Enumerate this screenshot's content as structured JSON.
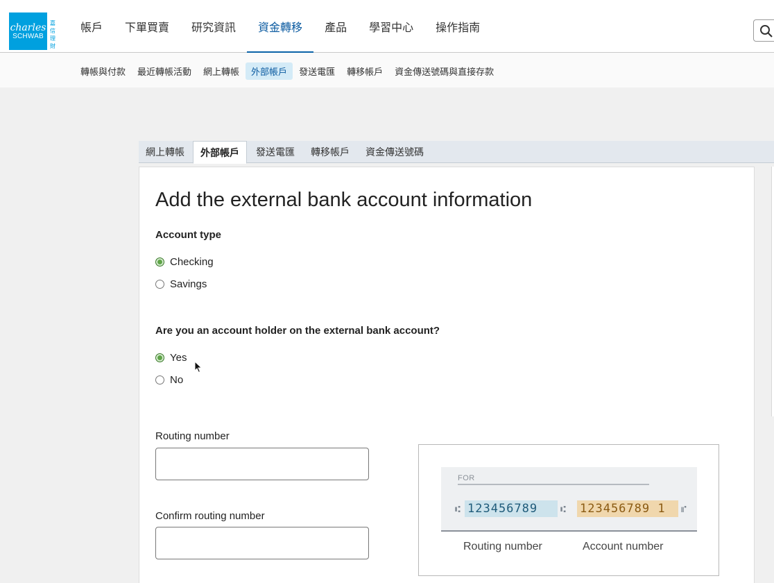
{
  "brand": {
    "logo_line1": "charles",
    "logo_line2": "SCHWAB",
    "logo_cn": "嘉信理財"
  },
  "main_nav": [
    "帳戶",
    "下單買賣",
    "研究資訊",
    "資金轉移",
    "產品",
    "學習中心",
    "操作指南"
  ],
  "main_nav_active": "資金轉移",
  "sub_nav": [
    "轉帳與付款",
    "最近轉帳活動",
    "網上轉帳",
    "外部帳戶",
    "發送電匯",
    "轉移帳戶",
    "資金傳送號碼與直接存款"
  ],
  "sub_nav_active": "外部帳戶",
  "tabs": [
    "網上轉帳",
    "外部帳戶",
    "發送電匯",
    "轉移帳戶",
    "資金傳送號碼"
  ],
  "tab_active": "外部帳戶",
  "form": {
    "title": "Add the external bank account information",
    "account_type": {
      "label": "Account type",
      "options": [
        "Checking",
        "Savings"
      ],
      "selected": "Checking"
    },
    "holder": {
      "label": "Are you an account holder on the external bank account?",
      "options": [
        "Yes",
        "No"
      ],
      "selected": "Yes"
    },
    "routing_label": "Routing number",
    "routing_value": "",
    "confirm_routing_label": "Confirm routing number",
    "confirm_routing_value": ""
  },
  "check_illustration": {
    "for_label": "FOR",
    "routing_digits": "123456789",
    "account_digits": "123456789 1",
    "routing_caption": "Routing number",
    "account_caption": "Account number"
  },
  "icons": {
    "search": "search-icon",
    "cursor": "mouse-pointer-icon"
  },
  "colors": {
    "brand": "#00a0df",
    "active_nav": "#0a5aa0",
    "radio_checked": "#5fa448"
  }
}
